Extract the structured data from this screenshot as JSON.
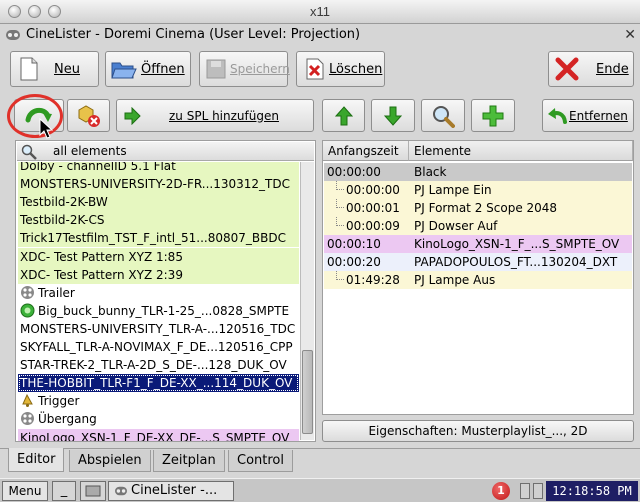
{
  "window": {
    "x11_title": "x11",
    "app_title": "CineLister - Doremi Cinema (User Level: Projection)"
  },
  "toolbar": {
    "new_label": "Neu",
    "open_label": "Öffnen",
    "save_label": "Speichern",
    "delete_label": "Löschen",
    "end_label": "Ende"
  },
  "actions": {
    "add_to_spl_label": "zu SPL hinzufügen",
    "remove_label": "Entfernen"
  },
  "left_panel": {
    "filter_label": "all elements",
    "items": [
      {
        "text": "Dolby - channelID 5.1 Flat",
        "style": "g",
        "icon": ""
      },
      {
        "text": "MONSTERS-UNIVERSITY-2D-FR...130312_TDC",
        "style": "g",
        "icon": ""
      },
      {
        "text": "Testbild-2K-BW",
        "style": "g",
        "icon": ""
      },
      {
        "text": "Testbild-2K-CS",
        "style": "g",
        "icon": ""
      },
      {
        "text": "Trick17Testfilm_TST_F_intl_51...80807_BBDC",
        "style": "g",
        "icon": ""
      },
      {
        "text": "XDC- Test Pattern XYZ 1:85",
        "style": "g",
        "icon": ""
      },
      {
        "text": "XDC- Test Pattern XYZ 2:39",
        "style": "g",
        "icon": ""
      },
      {
        "text": "Trailer",
        "style": "",
        "icon": "reel"
      },
      {
        "text": "Big_buck_bunny_TLR-1-25_...0828_SMPTE",
        "style": "",
        "icon": "green"
      },
      {
        "text": "MONSTERS-UNIVERSITY_TLR-A-...120516_TDC",
        "style": "",
        "icon": ""
      },
      {
        "text": "SKYFALL_TLR-A-NOVIMAX_F_DE...120516_CPP",
        "style": "",
        "icon": ""
      },
      {
        "text": "STAR-TREK-2_TLR-A-2D_S_DE-...128_DUK_OV",
        "style": "",
        "icon": ""
      },
      {
        "text": "THE-HOBBIT_TLR-F1_F_DE-XX_...114_DUK_OV",
        "style": "sel",
        "icon": ""
      },
      {
        "text": "Trigger",
        "style": "",
        "icon": "bell"
      },
      {
        "text": "Übergang",
        "style": "",
        "icon": "reel"
      },
      {
        "text": "KinoLogo_XSN-1_F_DE-XX_DE-...S_SMPTE_OV",
        "style": "pk",
        "icon": ""
      }
    ]
  },
  "right_panel": {
    "columns": [
      "Anfangszeit",
      "Elemente"
    ],
    "rows": [
      {
        "time": "00:00:00",
        "element": "Black",
        "style": "gr",
        "indent": false
      },
      {
        "time": "00:00:00",
        "element": "PJ Lampe Ein",
        "style": "yl",
        "indent": true
      },
      {
        "time": "00:00:01",
        "element": "PJ Format 2 Scope 2048",
        "style": "yl",
        "indent": true
      },
      {
        "time": "00:00:09",
        "element": "PJ Dowser Auf",
        "style": "yl",
        "indent": true
      },
      {
        "time": "00:00:10",
        "element": "KinoLogo_XSN-1_F_...S_SMPTE_OV",
        "style": "pk",
        "indent": false
      },
      {
        "time": "00:00:20",
        "element": "PAPADOPOULOS_FT...130204_DXT",
        "style": "bl",
        "indent": false
      },
      {
        "time": "01:49:28",
        "element": "PJ Lampe Aus",
        "style": "yl",
        "indent": true
      }
    ],
    "properties_label": "Eigenschaften: Musterplaylist_..., 2D"
  },
  "tabs": [
    "Editor",
    "Abspielen",
    "Zeitplan",
    "Control"
  ],
  "taskbar": {
    "menu_label": "Menu",
    "underscore_label": "_",
    "window_label": "CineLister -...",
    "notification_count": "1",
    "clock": "12:18:58 PM"
  },
  "colors": {
    "selected": "#0a1a78",
    "ingest_green": "#e6f7c0",
    "logo_pink": "#ecc8f2",
    "cue_yellow": "#fbf7d6",
    "highlight_ring": "#e0312a"
  }
}
